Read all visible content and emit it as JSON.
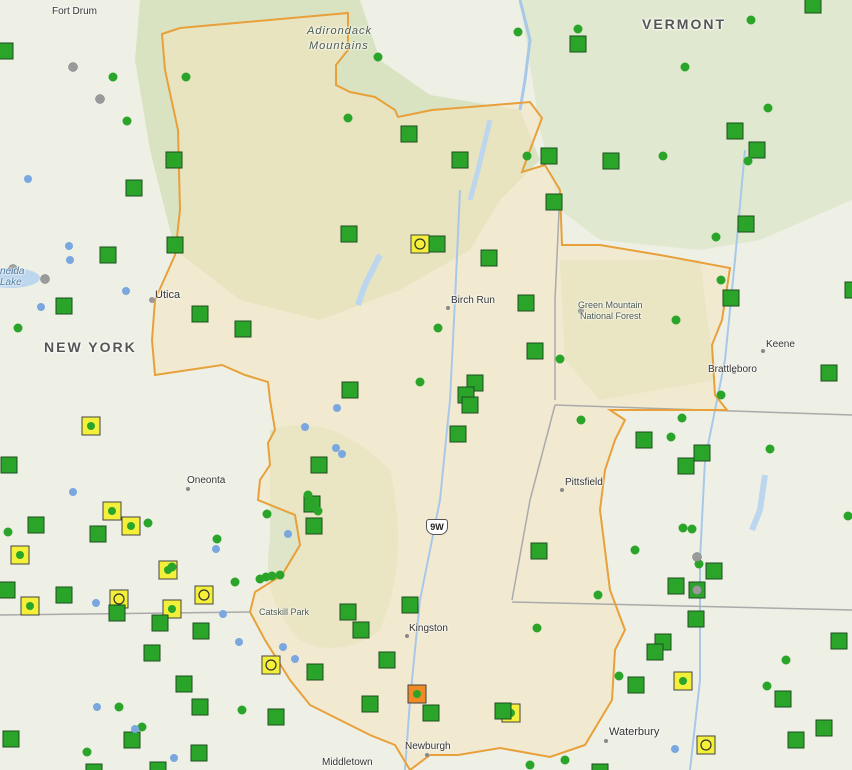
{
  "map": {
    "labels": {
      "fort_drum": "Fort Drum",
      "adirondack": "Adirondack",
      "mountains": "Mountains",
      "vermont": "VERMONT",
      "new_york": "NEW YORK",
      "lake_part1": "neida",
      "lake_part2": "Lake",
      "utica": "Utica",
      "birch_run": "Birch Run",
      "green_mountain": "Green Mountain",
      "national_forest": "National Forest",
      "keene": "Keene",
      "brattleboro": "Brattleboro",
      "oneonta": "Oneonta",
      "pittsfield": "Pittsfield",
      "route": "9W",
      "catskill": "Catskill Park",
      "kingston": "Kingston",
      "newburgh": "Newburgh",
      "middletown": "Middletown",
      "waterbury": "Waterbury"
    },
    "colors": {
      "boundary": "#e8a03a",
      "region_fill": "#f4e6c0",
      "forest_fill": "#c9d8a4",
      "station_green": "#2aa52a",
      "station_yellow": "#f4f03a",
      "station_orange": "#f08a24",
      "station_gray": "#9a9a9a",
      "station_blue": "#7aa7e0"
    }
  }
}
